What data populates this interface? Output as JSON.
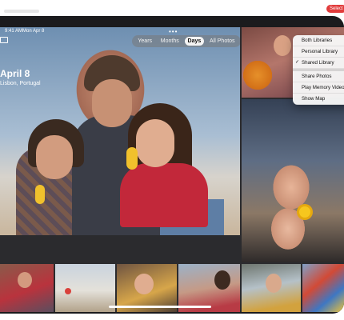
{
  "header": {
    "date_title": "April 8",
    "date_subtitle": "Lisbon, Portugal",
    "status_time": "9:41 AM",
    "status_day": "Mon Apr 8",
    "more_dots": "•••"
  },
  "view_switcher": {
    "options": [
      "Years",
      "Months",
      "Days",
      "All Photos"
    ],
    "selected": "Days"
  },
  "menu": {
    "items": [
      {
        "label": "Both Libraries",
        "checked": false
      },
      {
        "label": "Personal Library",
        "checked": false
      },
      {
        "label": "Shared Library",
        "checked": true
      },
      {
        "label": "Share Photos",
        "checked": false
      },
      {
        "label": "Play Memory Video",
        "checked": false
      },
      {
        "label": "Show Map",
        "checked": false
      }
    ]
  },
  "toolbar": {
    "select_label": "Select"
  },
  "colors": {
    "menu_bg": "#f6f6f6",
    "segment_active": "#f4f4f4",
    "select_button": "#e13b3b"
  }
}
